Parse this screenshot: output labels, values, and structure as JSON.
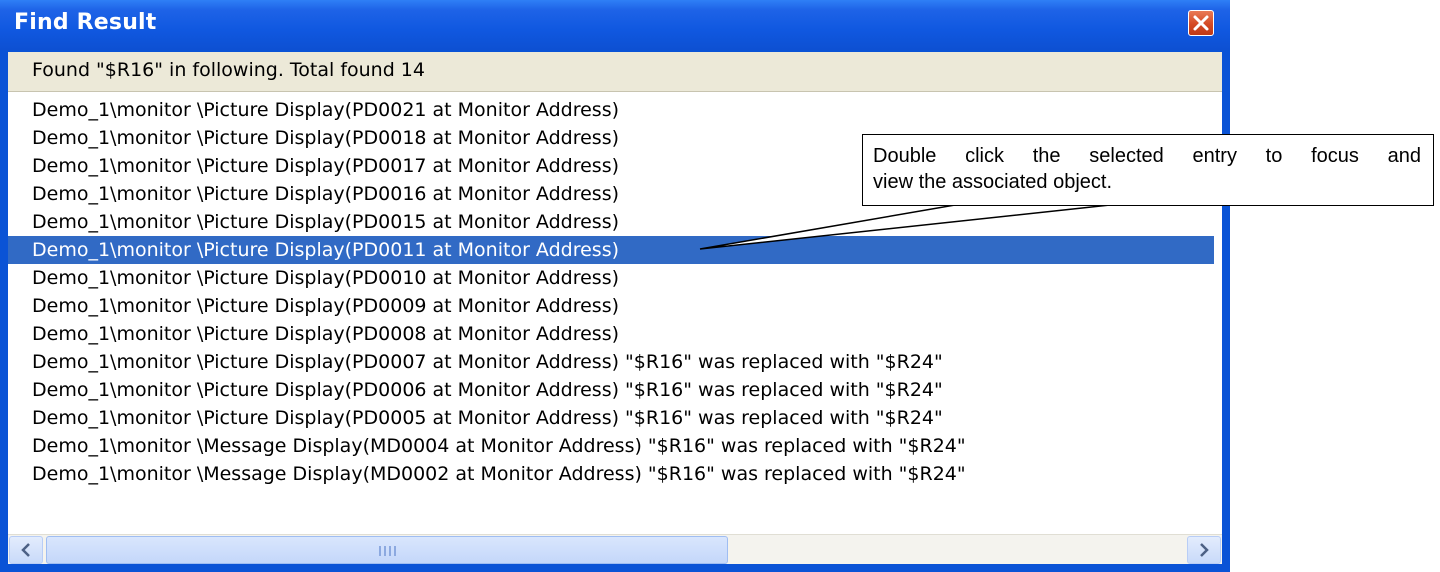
{
  "window": {
    "title": "Find Result"
  },
  "header": {
    "summary": "Found \"$R16\" in following. Total found 14"
  },
  "results": [
    "Demo_1\\monitor \\Picture Display(PD0021 at Monitor Address)",
    "Demo_1\\monitor \\Picture Display(PD0018 at Monitor Address)",
    "Demo_1\\monitor \\Picture Display(PD0017 at Monitor Address)",
    "Demo_1\\monitor \\Picture Display(PD0016 at Monitor Address)",
    "Demo_1\\monitor \\Picture Display(PD0015 at Monitor Address)",
    "Demo_1\\monitor \\Picture Display(PD0011 at Monitor Address)",
    "Demo_1\\monitor \\Picture Display(PD0010 at Monitor Address)",
    "Demo_1\\monitor \\Picture Display(PD0009 at Monitor Address)",
    "Demo_1\\monitor \\Picture Display(PD0008 at Monitor Address)",
    "Demo_1\\monitor \\Picture Display(PD0007 at Monitor Address) \"$R16\" was replaced with \"$R24\"",
    "Demo_1\\monitor \\Picture Display(PD0006 at Monitor Address) \"$R16\" was replaced with \"$R24\"",
    "Demo_1\\monitor \\Picture Display(PD0005 at Monitor Address) \"$R16\" was replaced with \"$R24\"",
    "Demo_1\\monitor \\Message Display(MD0004 at Monitor Address) \"$R16\" was replaced with \"$R24\"",
    "Demo_1\\monitor \\Message Display(MD0002 at Monitor Address) \"$R16\" was replaced with \"$R24\""
  ],
  "selected_index": 5,
  "callout": {
    "line1": "Double click the selected entry to focus and",
    "line2": "view the associated object."
  },
  "icons": {
    "close": "close-icon",
    "scroll_left": "arrow-left-icon",
    "scroll_right": "arrow-right-icon"
  },
  "colors": {
    "titlebar": "#0d50d2",
    "selection": "#316ac5",
    "header_bg": "#ece9d8",
    "close_button": "#d44a24"
  }
}
